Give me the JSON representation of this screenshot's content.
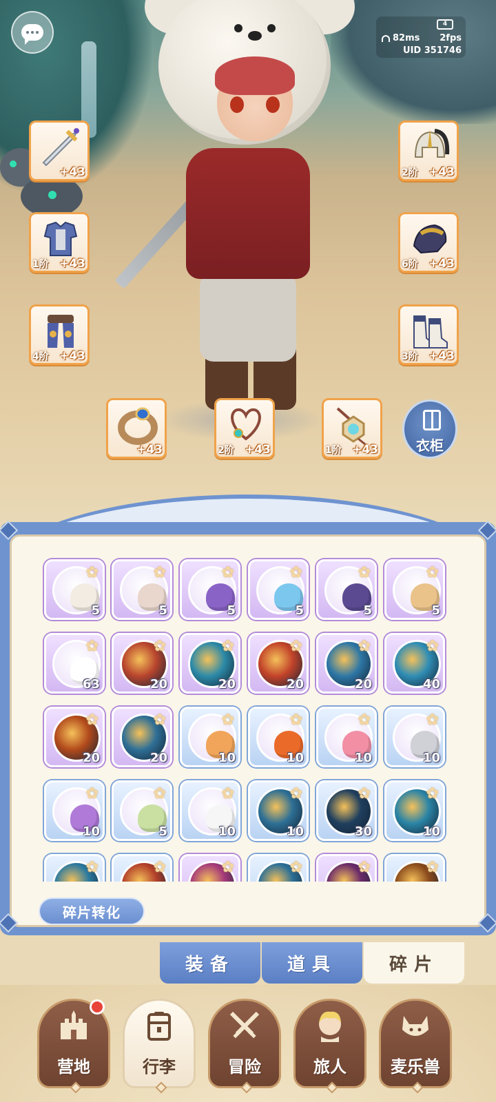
{
  "hud": {
    "ping": "82ms",
    "fps": "2fps",
    "uid": "UID 351746",
    "battery_label": "4"
  },
  "equipment": {
    "left": [
      {
        "name": "sword",
        "stage": "",
        "level": "+43"
      },
      {
        "name": "armor",
        "stage": "1阶",
        "level": "+43"
      },
      {
        "name": "greaves",
        "stage": "4阶",
        "level": "+43"
      }
    ],
    "right": [
      {
        "name": "helmet",
        "stage": "2阶",
        "level": "+43"
      },
      {
        "name": "gloves",
        "stage": "6阶",
        "level": "+43"
      },
      {
        "name": "boots",
        "stage": "3阶",
        "level": "+43"
      }
    ],
    "accessories": [
      {
        "name": "ring",
        "stage": "",
        "level": "+43"
      },
      {
        "name": "necklace",
        "stage": "2阶",
        "level": "+43"
      },
      {
        "name": "amulet",
        "stage": "1阶",
        "level": "+43"
      }
    ],
    "wardrobe_label": "衣柜"
  },
  "fragments": [
    {
      "count": "5",
      "rarity": "purple",
      "kind": "creature",
      "color": "#f3ece3"
    },
    {
      "count": "5",
      "rarity": "purple",
      "kind": "creature",
      "color": "#e9d6cc"
    },
    {
      "count": "5",
      "rarity": "purple",
      "kind": "creature",
      "color": "#8a63c6"
    },
    {
      "count": "5",
      "rarity": "purple",
      "kind": "creature",
      "color": "#7cc7ee"
    },
    {
      "count": "5",
      "rarity": "purple",
      "kind": "creature",
      "color": "#5b4a92"
    },
    {
      "count": "5",
      "rarity": "purple",
      "kind": "creature",
      "color": "#eac38a"
    },
    {
      "count": "63",
      "rarity": "purple",
      "kind": "creature",
      "color": "#ffffff"
    },
    {
      "count": "20",
      "rarity": "purple",
      "kind": "skill",
      "color": "#b8452e"
    },
    {
      "count": "20",
      "rarity": "purple",
      "kind": "skill",
      "color": "#2c8aa8"
    },
    {
      "count": "20",
      "rarity": "purple",
      "kind": "skill",
      "color": "#c2432a"
    },
    {
      "count": "20",
      "rarity": "purple",
      "kind": "skill",
      "color": "#2d77a6"
    },
    {
      "count": "40",
      "rarity": "purple",
      "kind": "skill",
      "color": "#2f8db5"
    },
    {
      "count": "20",
      "rarity": "purple",
      "kind": "skill",
      "color": "#b24a1c"
    },
    {
      "count": "20",
      "rarity": "purple",
      "kind": "skill",
      "color": "#2f6f96"
    },
    {
      "count": "10",
      "rarity": "blue",
      "kind": "creature",
      "color": "#f1a55a"
    },
    {
      "count": "10",
      "rarity": "blue",
      "kind": "creature",
      "color": "#ea6a2a"
    },
    {
      "count": "10",
      "rarity": "blue",
      "kind": "creature",
      "color": "#f28fa5"
    },
    {
      "count": "10",
      "rarity": "blue",
      "kind": "creature",
      "color": "#cfd1d6"
    },
    {
      "count": "10",
      "rarity": "blue",
      "kind": "creature",
      "color": "#b07ad8"
    },
    {
      "count": "5",
      "rarity": "blue",
      "kind": "creature",
      "color": "#c9e0a2"
    },
    {
      "count": "10",
      "rarity": "blue",
      "kind": "creature",
      "color": "#f6f6f6"
    },
    {
      "count": "10",
      "rarity": "blue",
      "kind": "skill",
      "color": "#2d6f95"
    },
    {
      "count": "30",
      "rarity": "blue",
      "kind": "skill",
      "color": "#1f3f5e"
    },
    {
      "count": "10",
      "rarity": "blue",
      "kind": "skill",
      "color": "#2a84a6"
    },
    {
      "count": "",
      "rarity": "blue",
      "kind": "skill",
      "color": "#2b7aa0"
    },
    {
      "count": "",
      "rarity": "blue",
      "kind": "skill",
      "color": "#b2402a"
    },
    {
      "count": "",
      "rarity": "purple",
      "kind": "skill",
      "color": "#a53a7a"
    },
    {
      "count": "",
      "rarity": "blue",
      "kind": "skill",
      "color": "#2c6f96"
    },
    {
      "count": "",
      "rarity": "purple",
      "kind": "skill",
      "color": "#6a2a6a"
    },
    {
      "count": "",
      "rarity": "blue",
      "kind": "skill",
      "color": "#8a4a1c"
    }
  ],
  "convert_button": "碎片转化",
  "tabs": [
    {
      "label": "装备",
      "active": false
    },
    {
      "label": "道具",
      "active": false
    },
    {
      "label": "碎片",
      "active": true
    }
  ],
  "bottom_nav": [
    {
      "label": "营地",
      "icon": "castle-icon",
      "active": false,
      "badge": true
    },
    {
      "label": "行李",
      "icon": "backpack-icon",
      "active": true,
      "badge": false
    },
    {
      "label": "冒险",
      "icon": "crossed-swords-icon",
      "active": false,
      "badge": false
    },
    {
      "label": "旅人",
      "icon": "traveler-icon",
      "active": false,
      "badge": false
    },
    {
      "label": "麦乐兽",
      "icon": "pet-icon",
      "active": false,
      "badge": false
    }
  ],
  "colors": {
    "accent_blue": "#6f93cf",
    "slot_orange": "#f0a24a",
    "notification_red": "#e8443a"
  }
}
